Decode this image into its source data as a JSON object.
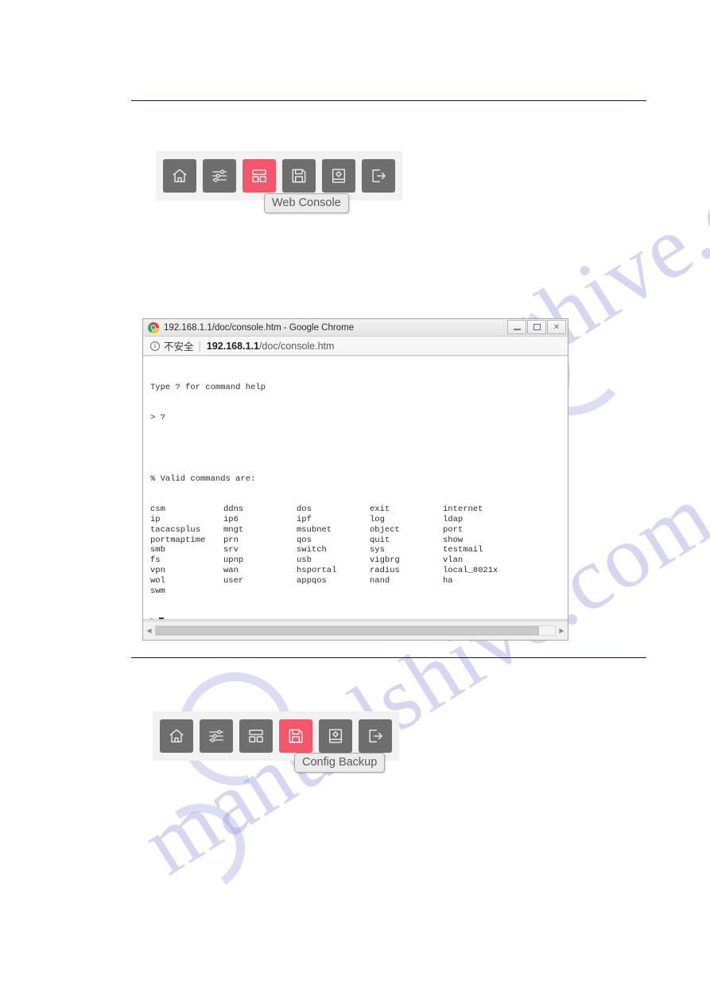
{
  "page": {
    "watermark_text": "manualshive.com"
  },
  "toolbar_top": {
    "buttons": [
      {
        "icon": "home-icon",
        "name": "home",
        "active": false
      },
      {
        "icon": "sliders-icon",
        "name": "quick-settings",
        "active": false
      },
      {
        "icon": "web-console-icon",
        "name": "web-console",
        "active": true
      },
      {
        "icon": "save-disk-icon",
        "name": "config-backup",
        "active": false
      },
      {
        "icon": "manual-gear-icon",
        "name": "manual",
        "active": false
      },
      {
        "icon": "logout-icon",
        "name": "logout",
        "active": false
      }
    ],
    "tooltip": "Web Console"
  },
  "toolbar_bottom": {
    "buttons": [
      {
        "icon": "home-icon",
        "name": "home",
        "active": false
      },
      {
        "icon": "sliders-icon",
        "name": "quick-settings",
        "active": false
      },
      {
        "icon": "web-console-icon",
        "name": "web-console",
        "active": false
      },
      {
        "icon": "save-disk-icon",
        "name": "config-backup",
        "active": true
      },
      {
        "icon": "manual-gear-icon",
        "name": "manual",
        "active": false
      },
      {
        "icon": "logout-icon",
        "name": "logout",
        "active": false
      }
    ],
    "tooltip": "Config Backup"
  },
  "browser": {
    "title": "192.168.1.1/doc/console.htm - Google Chrome",
    "window_controls": {
      "minimize": "minimize-icon",
      "maximize": "maximize-icon",
      "close": "close-icon"
    },
    "omnibar": {
      "security_icon": "info-circle-icon",
      "security_label": "不安全",
      "separator": "|",
      "url_host": "192.168.1.1",
      "url_path": "/doc/console.htm"
    },
    "console": {
      "line_1": "Type ? for command help",
      "line_2": "> ?",
      "line_3": "",
      "line_4": "% Valid commands are:",
      "commands": [
        [
          "csm",
          "ddns",
          "dos",
          "exit",
          "internet",
          "ip"
        ],
        [
          "ip6",
          "ipf",
          "log",
          "ldap",
          "tacacsplus",
          "mngt"
        ],
        [
          "msubnet",
          "object",
          "port",
          "portmaptime",
          "prn",
          "qos"
        ],
        [
          "quit",
          "show",
          "smb",
          "srv",
          "switch",
          "sys"
        ],
        [
          "testmail",
          "fs",
          "upnp",
          "usb",
          "vigbrg",
          "vlan"
        ],
        [
          "vpn",
          "wan",
          "hsportal",
          "radius",
          "local_8021x",
          "wol"
        ],
        [
          "user",
          "appqos",
          "nand",
          "ha",
          "swm",
          ""
        ]
      ],
      "prompt": ">"
    },
    "scrollbar": {
      "left_arrow": "scroll-left-icon",
      "right_arrow": "scroll-right-icon"
    }
  }
}
